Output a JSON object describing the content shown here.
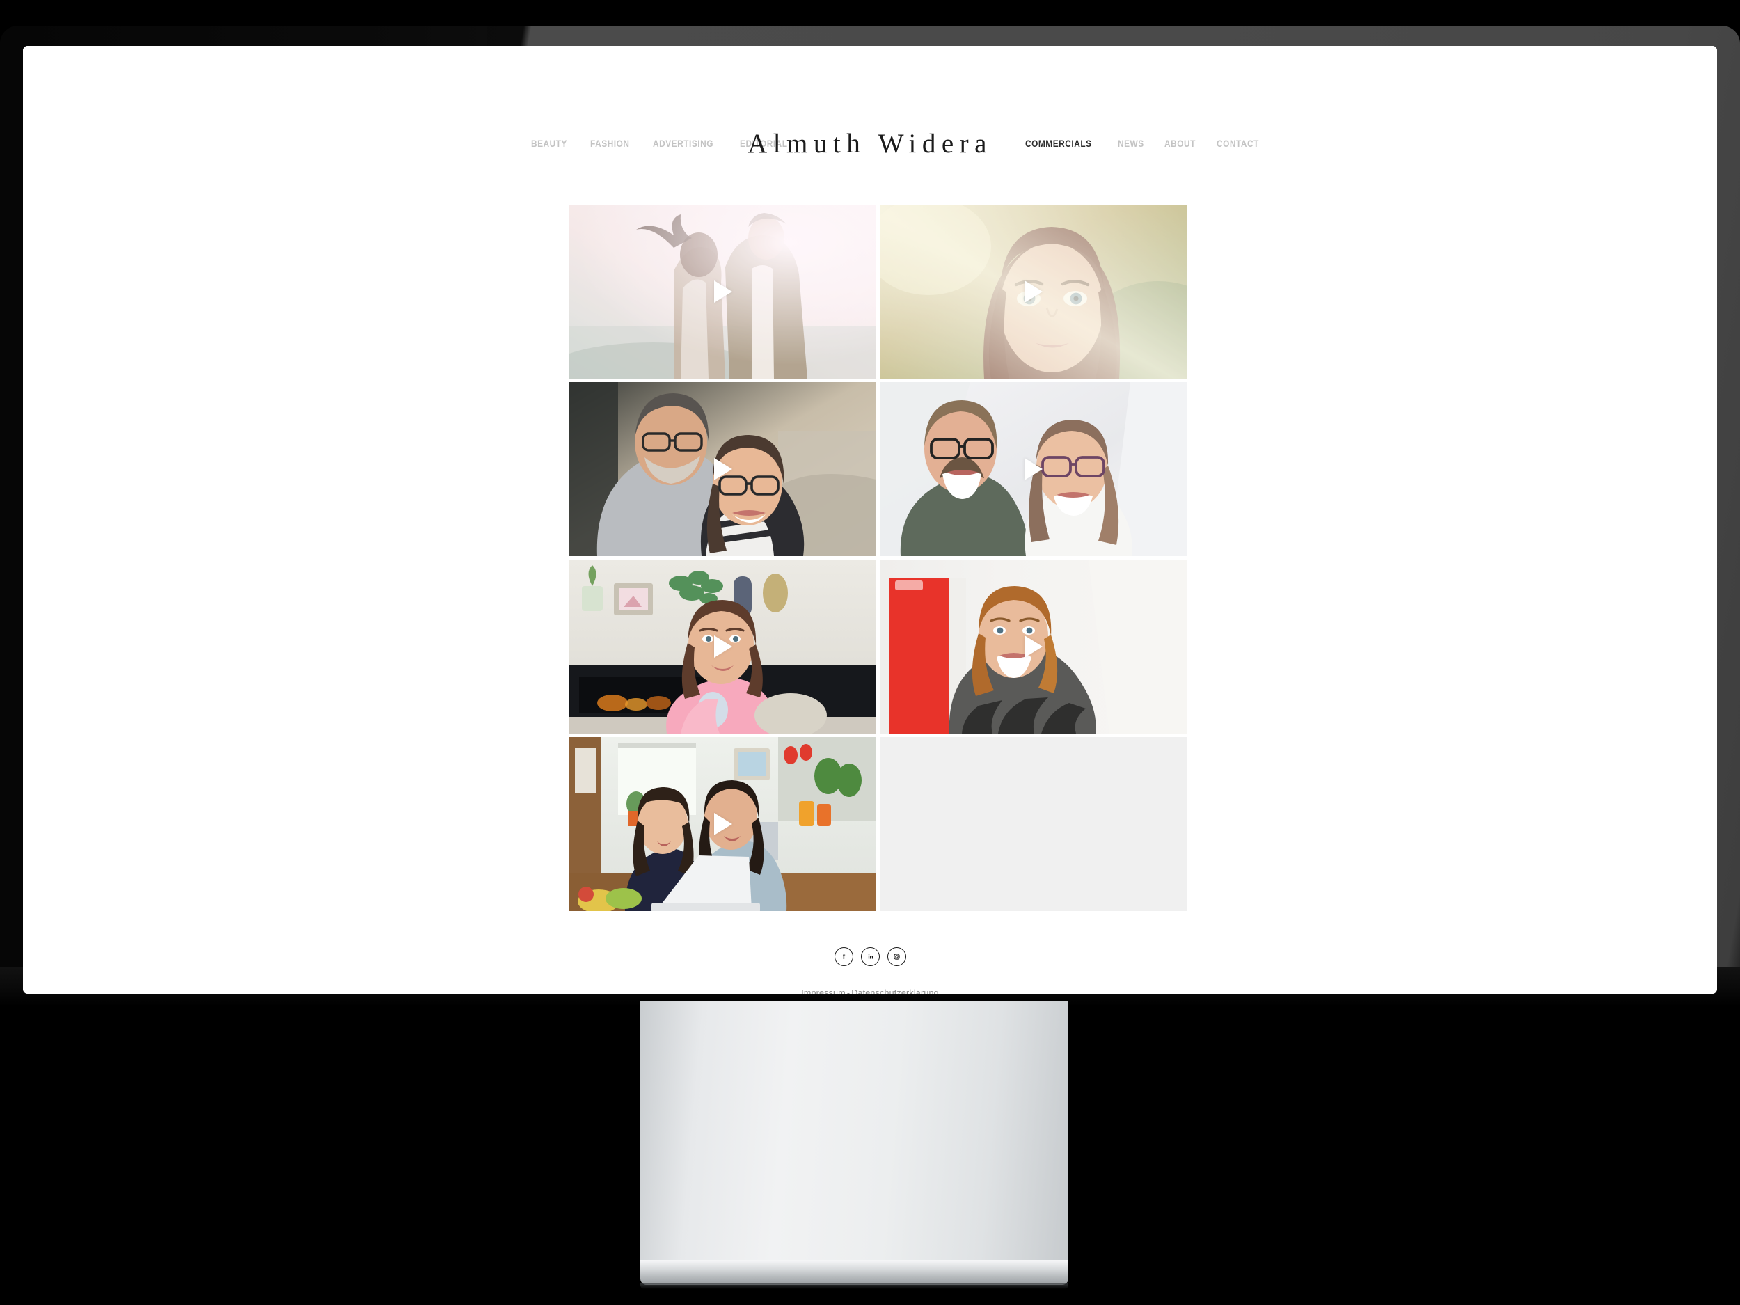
{
  "site": {
    "brand": "Almuth  Widera",
    "nav_left": [
      {
        "label": "BEAUTY"
      },
      {
        "label": "FASHION"
      },
      {
        "label": "ADVERTISING"
      },
      {
        "label": "EDITORIAL"
      }
    ],
    "nav_right": [
      {
        "label": "COMMERCIALS",
        "active": true
      },
      {
        "label": "NEWS",
        "active": false
      },
      {
        "label": "ABOUT",
        "active": false
      },
      {
        "label": "CONTACT",
        "active": false
      }
    ]
  },
  "gallery": {
    "rows": [
      [
        {
          "name": "couple-sunset-beach",
          "has_play": true,
          "empty": false
        },
        {
          "name": "woman-portrait-sunlight",
          "has_play": true,
          "empty": false
        }
      ],
      [
        {
          "name": "couple-glasses-sofa",
          "has_play": true,
          "empty": false
        },
        {
          "name": "couple-glasses-laughing",
          "has_play": true,
          "empty": false
        }
      ],
      [
        {
          "name": "woman-pink-sweater-fireplace",
          "has_play": true,
          "empty": false
        },
        {
          "name": "woman-red-background-smiling",
          "has_play": true,
          "empty": false
        }
      ],
      [
        {
          "name": "two-women-laptop-kitchen",
          "has_play": true,
          "empty": false
        },
        {
          "name": "empty-placeholder",
          "has_play": false,
          "empty": true
        }
      ]
    ],
    "play_label": "play-video"
  },
  "footer": {
    "social": [
      {
        "icon": "facebook-icon",
        "label": "Facebook"
      },
      {
        "icon": "linkedin-icon",
        "label": "LinkedIn"
      },
      {
        "icon": "instagram-icon",
        "label": "Instagram"
      }
    ],
    "legal": {
      "impressum": "Impressum",
      "separator": "-",
      "privacy": "Datenschutzerklärung"
    }
  },
  "colors": {
    "brand_text": "#1b1b1b",
    "nav_inactive": "#c3c3c3",
    "nav_active": "#2c2c2c",
    "legal_text": "#8a8a8a",
    "page_bg": "#ffffff",
    "placeholder_bg": "#f0f0f0",
    "bezel_dark": "#0d0d0d",
    "bezel_light": "#474747",
    "stand_silver": "#e7e9eb"
  }
}
